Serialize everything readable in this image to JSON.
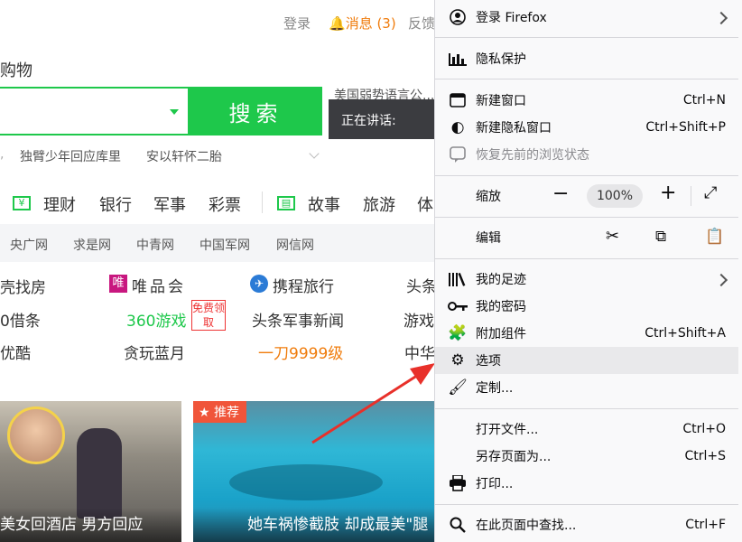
{
  "topbar": {
    "login": "登录",
    "notice": "消息 (3)",
    "feedback": "反馈"
  },
  "category_fragment": "购物",
  "search": {
    "button": "搜索",
    "news_fragment": "美国弱势语言公..."
  },
  "hot_searches": [
    "独臂少年回应库里",
    "安以轩怀二胎"
  ],
  "nav": {
    "items": [
      "理财",
      "银行",
      "军事",
      "彩票",
      "故事",
      "旅游",
      "体"
    ]
  },
  "subnav": [
    "央广网",
    "求是网",
    "中青网",
    "中国军网",
    "网信网"
  ],
  "sites": {
    "row1": [
      "壳找房",
      "唯品会",
      "携程旅行",
      "头条"
    ],
    "row2": [
      "0借条",
      "360游戏",
      "头条军事新闻",
      "游戏"
    ],
    "row3": [
      "优酷",
      "贪玩蓝月",
      "一刀9999级",
      "中华"
    ],
    "free_badge": "免费领取"
  },
  "cards": [
    {
      "caption": "美女回酒店 男方回应"
    },
    {
      "badge": "推荐",
      "caption": "她车祸惨截肢 却成最美\"腿"
    }
  ],
  "speaking": {
    "label": "正在讲话:"
  },
  "menu": {
    "items": [
      {
        "label": "登录 Firefox",
        "icon": "account-icon",
        "submenu": true
      },
      {
        "label": "隐私保护",
        "icon": "chart-icon"
      },
      {
        "label": "新建窗口",
        "shortcut": "Ctrl+N"
      },
      {
        "label": "新建隐私窗口",
        "shortcut": "Ctrl+Shift+P"
      },
      {
        "label": "恢复先前的浏览状态",
        "icon": "restore-icon",
        "disabled": true
      },
      {
        "label": "缩放",
        "zoom": "100%"
      },
      {
        "label": "编辑"
      },
      {
        "label": "我的足迹",
        "icon": "library-icon",
        "submenu": true
      },
      {
        "label": "我的密码",
        "icon": "key-icon"
      },
      {
        "label": "附加组件",
        "icon": "puzzle-icon",
        "shortcut": "Ctrl+Shift+A"
      },
      {
        "label": "选项",
        "icon": "gear-icon"
      },
      {
        "label": "定制...",
        "icon": "brush-icon"
      },
      {
        "label": "打开文件...",
        "shortcut": "Ctrl+O"
      },
      {
        "label": "另存页面为...",
        "shortcut": "Ctrl+S"
      },
      {
        "label": "打印...",
        "icon": "printer-icon"
      },
      {
        "label": "在此页面中查找...",
        "icon": "search-icon",
        "shortcut": "Ctrl+F"
      }
    ]
  },
  "colors": {
    "green": "#1ec84b",
    "orange": "#f07c0c",
    "arrow": "#e8302a"
  }
}
